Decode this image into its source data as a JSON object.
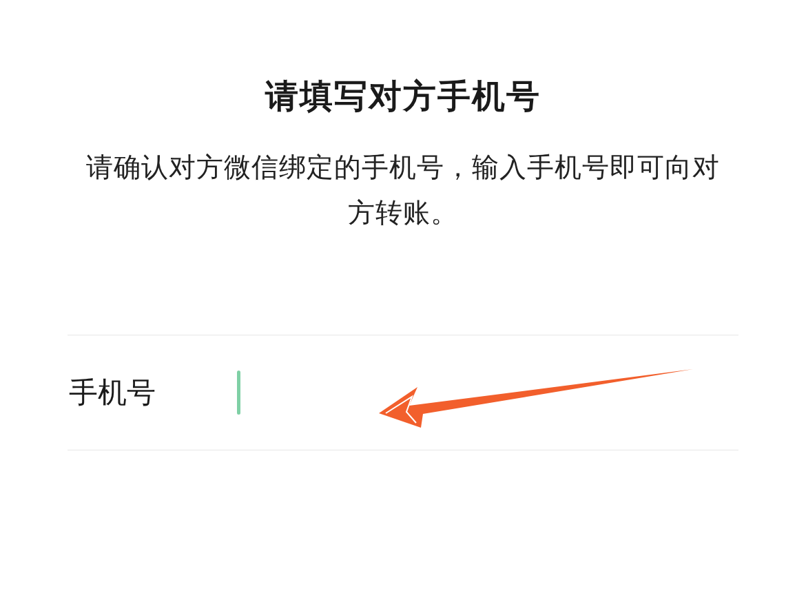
{
  "title": "请填写对方手机号",
  "description": "请确认对方微信绑定的手机号，输入手机号即可向对方转账。",
  "phone_field": {
    "label": "手机号",
    "focused": true
  }
}
